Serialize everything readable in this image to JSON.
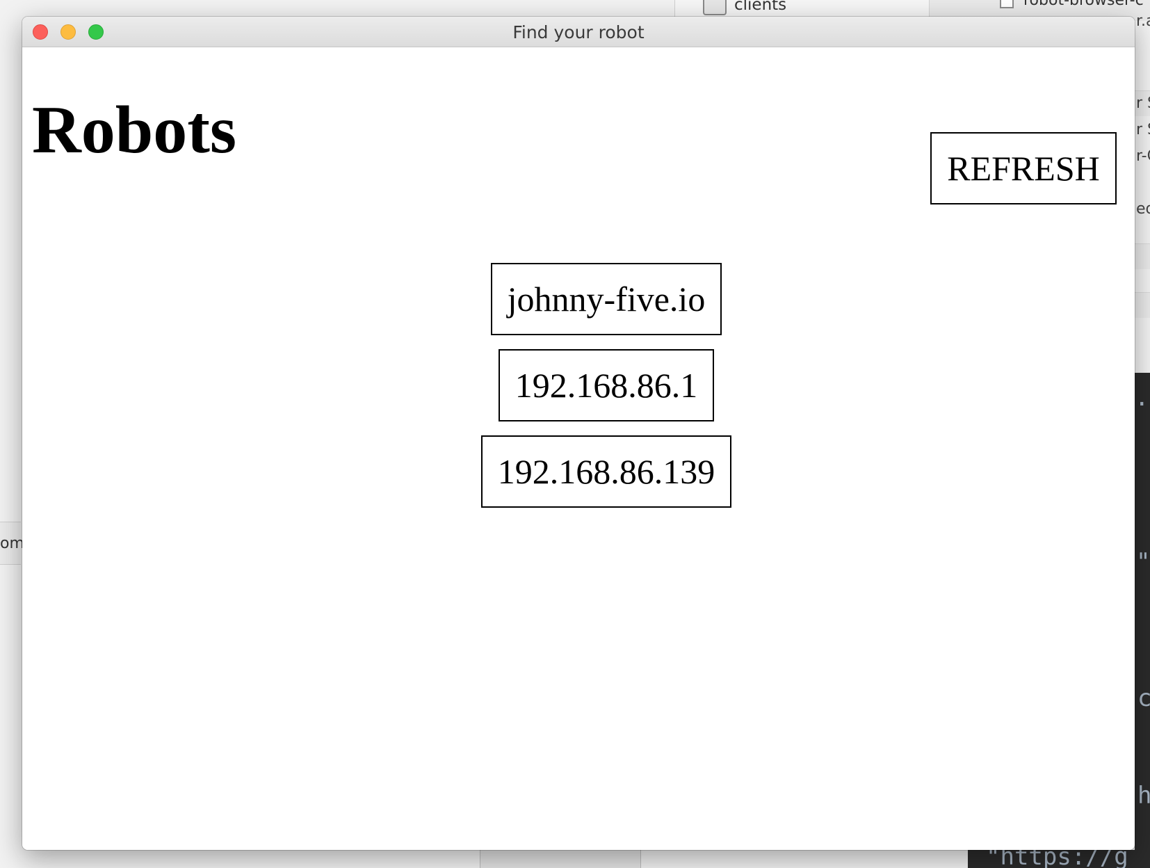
{
  "window": {
    "title": "Find your robot"
  },
  "page": {
    "heading": "Robots",
    "refresh_label": "REFRESH"
  },
  "robots": [
    {
      "label": "johnny-five.io"
    },
    {
      "label": "192.168.86.1"
    },
    {
      "label": "192.168.86.139"
    }
  ],
  "background": {
    "finder_folder_label": "clients",
    "finder_file_label": "robot-browser-c",
    "right_snippets": [
      "r.a",
      "r S",
      "r S",
      "r-C",
      "ed"
    ],
    "editor_snippets": [
      ".i",
      "\"",
      "c",
      "h"
    ],
    "editor_bottom_text": "\"https://g",
    "left_snippet": "omr"
  },
  "colors": {
    "traffic_close": "#fc605b",
    "traffic_minimize": "#fdbc40",
    "traffic_zoom": "#34c84a",
    "editor_bg": "#2b2b2b"
  }
}
